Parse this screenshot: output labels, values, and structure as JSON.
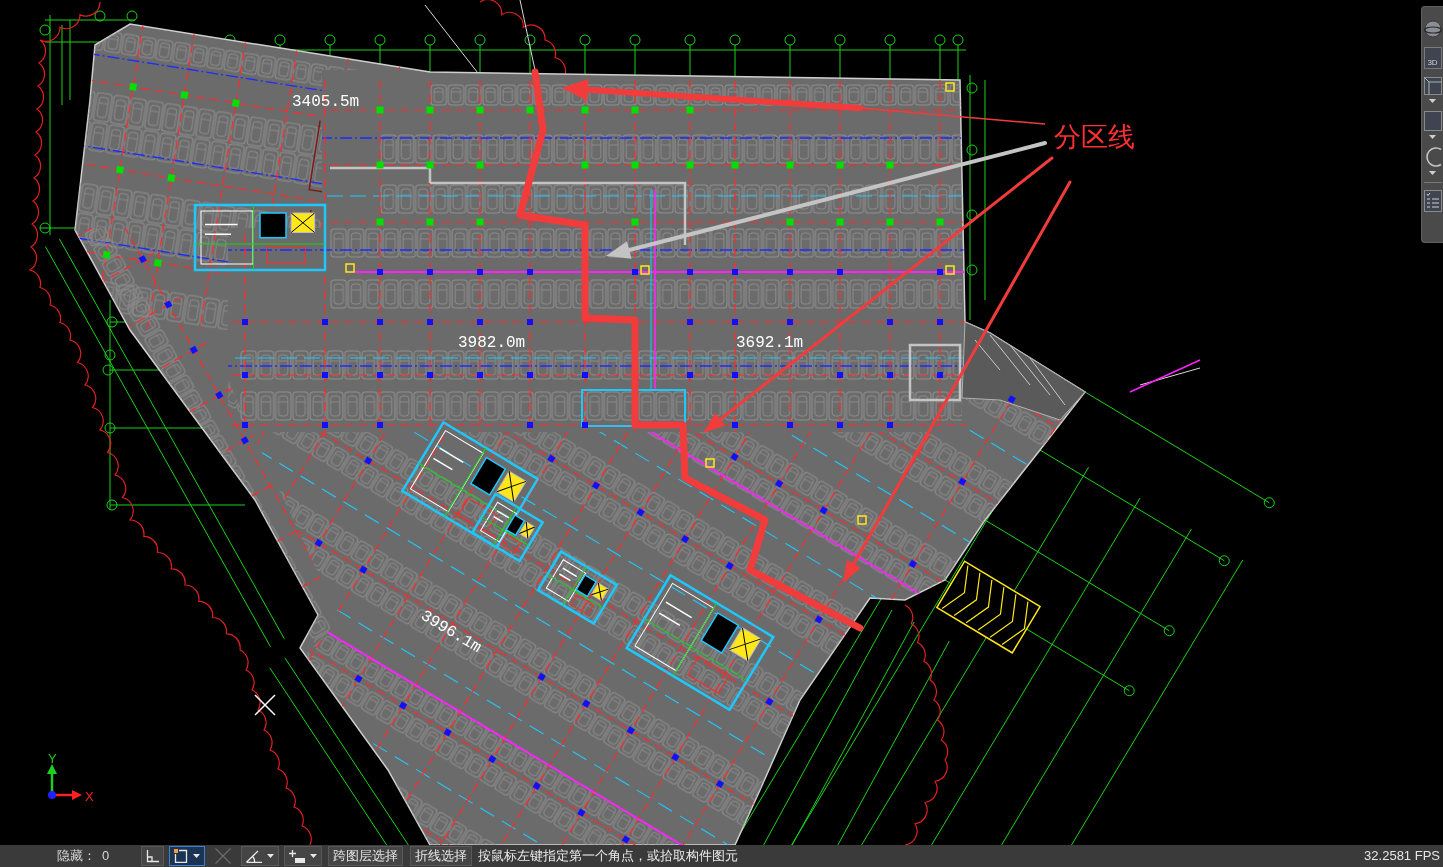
{
  "drawing": {
    "zone_label": "分区线",
    "area_labels": [
      "3405.5m",
      "3982.0m",
      "3692.1m",
      "3996.1m"
    ]
  },
  "ucs": {
    "y_label": "Y",
    "x_label": "X"
  },
  "view_toolbar": {
    "cube_label": "3D"
  },
  "status_bar": {
    "hidden_label": "隐藏：",
    "hidden_count": "0",
    "tools": [
      {
        "kind": "ortho",
        "selected": false,
        "disabled": false
      },
      {
        "kind": "snap",
        "selected": true,
        "disabled": false
      },
      {
        "kind": "cross",
        "selected": false,
        "disabled": true
      },
      {
        "kind": "angle",
        "selected": false,
        "disabled": false
      },
      {
        "kind": "grid",
        "selected": false,
        "disabled": false
      }
    ],
    "buttons": [
      "跨图层选择",
      "折线选择"
    ],
    "prompt": "按鼠标左键指定第一个角点，或拾取构件图元",
    "fps": "32.2581 FPS"
  }
}
